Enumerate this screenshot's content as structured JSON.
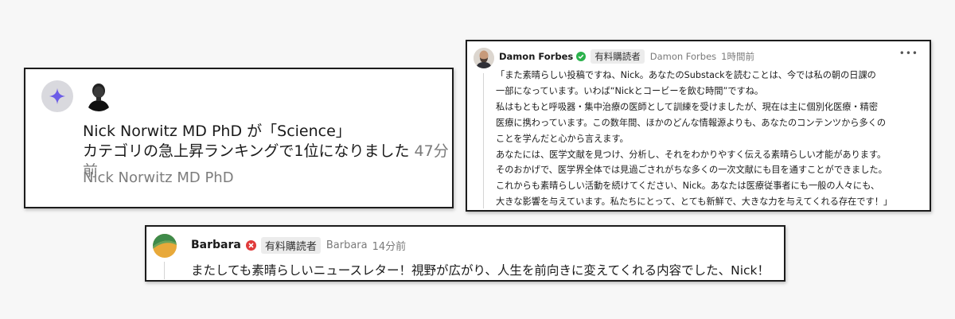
{
  "notification": {
    "line1": "Nick Norwitz MD PhD が「Science」",
    "line2": "カテゴリの急上昇ランキングで1位になりました",
    "time": "47分前",
    "author": "Nick Norwitz MD PhD",
    "icons": {
      "type": "sparkle-icon",
      "avatar": "person-avatar"
    },
    "colors": {
      "sparkle": "#6b5ce7",
      "circle": "#d9d9de"
    }
  },
  "comments": [
    {
      "name": "Damon Forbes",
      "badge": "有料購読者",
      "handle": "Damon Forbes",
      "time": "1時間前",
      "verified_color": "#2bb24c",
      "lines": [
        "「また素晴らしい投稿ですね、Nick。あなたのSubstackを読むことは、今では私の朝の日課の",
        "一部になっています。いわば“Nickとコービーを飲む時間”ですね。",
        "私はもともと呼吸器・集中治療の医師として訓練を受けましたが、現在は主に個別化医療・精密",
        "医療に携わっています。この数年間、ほかのどんな情報源よりも、あなたのコンテンツから多くの",
        "ことを学んだと心から言えます。",
        "あなたには、医学文献を見つけ、分析し、それをわかりやすく伝える素晴らしい才能があります。",
        "そのおかげで、医学界全体では見過ごされがちな多くの一次文献にも目を通すことができました。",
        "これからも素晴らしい活動を続けてください、Nick。あなたは医療従事者にも一般の人々にも、",
        "大きな影響を与えています。私たちにとって、とても新鮮で、大きな力を与えてくれる存在です！」"
      ]
    },
    {
      "name": "Barbara",
      "badge": "有料購読者",
      "handle": "Barbara",
      "time": "14分前",
      "icon_color": "#e03a3a",
      "text": "またしても素晴らしいニュースレター！視野が広がり、人生を前向きに変えてくれる内容でした、Nick！"
    }
  ]
}
